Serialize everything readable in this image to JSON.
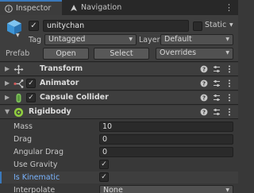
{
  "tabs": [
    {
      "label": "Inspector",
      "icon": "info-icon"
    },
    {
      "label": "Navigation",
      "icon": "navigation-icon"
    }
  ],
  "gameobject": {
    "active_check": "✓",
    "name": "unitychan",
    "static_label": "Static"
  },
  "tag": {
    "label": "Tag",
    "value": "Untagged"
  },
  "layer": {
    "label": "Layer",
    "value": "Default"
  },
  "prefab": {
    "label": "Prefab",
    "open": "Open",
    "select": "Select",
    "overrides": "Overrides"
  },
  "components": [
    {
      "name": "Transform",
      "icon": "transform-icon",
      "expanded": false
    },
    {
      "name": "Animator",
      "icon": "animator-icon",
      "enabled": "✓",
      "expanded": false
    },
    {
      "name": "Capsule Collider",
      "icon": "capsule-collider-icon",
      "enabled": "✓",
      "expanded": false
    },
    {
      "name": "Rigidbody",
      "icon": "rigidbody-icon",
      "expanded": true
    }
  ],
  "rigidbody": {
    "mass": {
      "label": "Mass",
      "value": "10"
    },
    "drag": {
      "label": "Drag",
      "value": "0"
    },
    "angular_drag": {
      "label": "Angular Drag",
      "value": "0"
    },
    "use_gravity": {
      "label": "Use Gravity",
      "value": "✓"
    },
    "is_kinematic": {
      "label": "Is Kinematic",
      "value": "✓"
    },
    "interpolate": {
      "label": "Interpolate",
      "value": "None"
    }
  },
  "colors": {
    "accent": "#3a79bb",
    "selected_label": "#7ab4ff",
    "panel_bg": "#383838",
    "header_bg": "#3e3e3e"
  }
}
